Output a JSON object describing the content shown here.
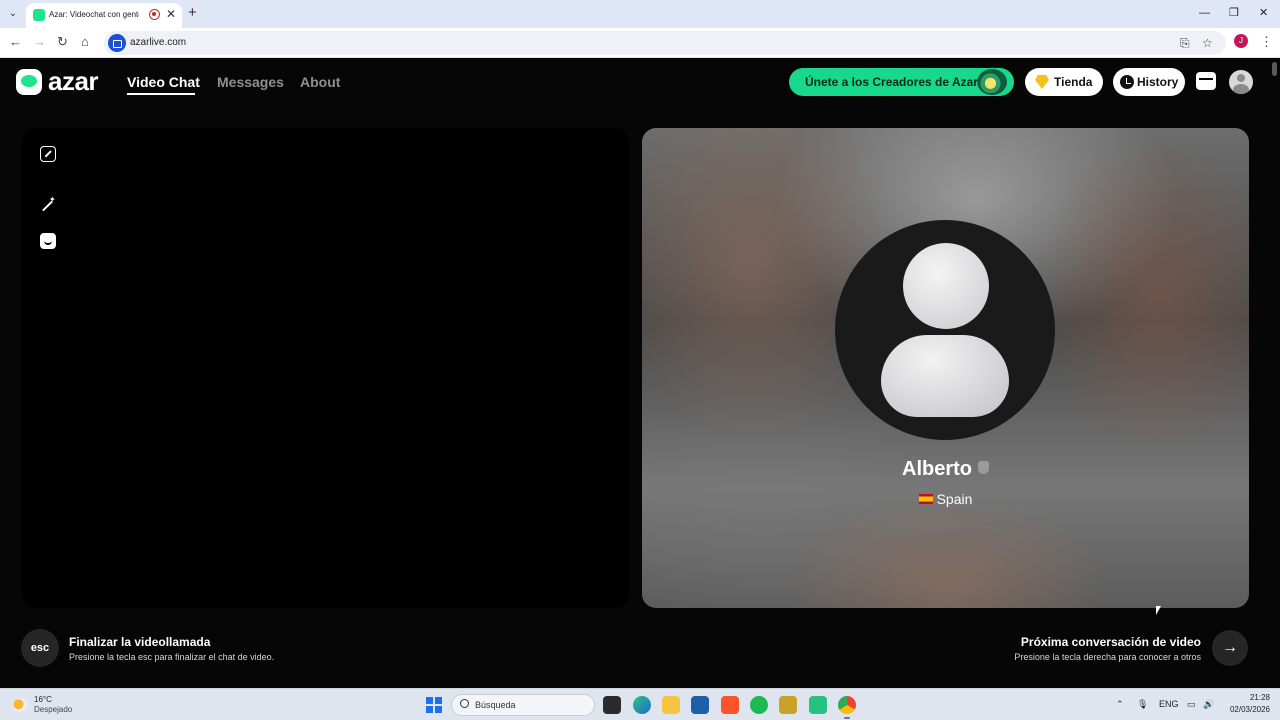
{
  "browser": {
    "tab_title": "Azar: Videochat con gente",
    "tab_close": "✕",
    "new_tab": "+",
    "url": "azarlive.com",
    "profile_initial": "J",
    "window_controls": {
      "minimize": "—",
      "maximize": "❐",
      "close": "✕"
    }
  },
  "header": {
    "logo_text": "azar",
    "nav": {
      "video_chat": "Video Chat",
      "messages": "Messages",
      "about": "About"
    },
    "creators_label": "Únete a los Creadores de Azar",
    "store_label": "Tienda",
    "history_label": "History"
  },
  "peer": {
    "name": "Alberto",
    "country": "Spain"
  },
  "controls": {
    "esc_key": "esc",
    "end_title": "Finalizar la videollamada",
    "end_desc": "Presione la tecla esc para finalizar el chat de video.",
    "next_title": "Próxima conversación de video",
    "next_desc": "Presione la tecla derecha para conocer a otros",
    "next_arrow": "→"
  },
  "taskbar": {
    "weather_temp": "16°C",
    "weather_desc": "Despejado",
    "search_placeholder": "Búsqueda",
    "language": "ENG",
    "time": "21:28",
    "date": "02/03/2026"
  },
  "colors": {
    "accent_green": "#18d98b",
    "page_background": "#060606",
    "store_gem": "#f4c21a"
  }
}
